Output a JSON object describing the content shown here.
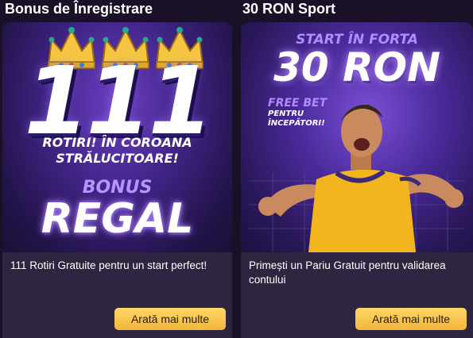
{
  "sections": [
    {
      "title": "Bonus de Înregistrare",
      "banner": {
        "number": "111",
        "line1": "ROTIRI! ÎN COROANA",
        "line2": "STRĂLUCITOARE!",
        "bonus": "BONUS",
        "regal": "REGAL"
      },
      "description": "111 Rotiri Gratuite pentru un start perfect!",
      "button_label": "Arată mai multe"
    },
    {
      "title": "30 RON Sport",
      "banner": {
        "start": "START ÎN FORTA",
        "amount": "30 RON",
        "free_bet": "FREE BET",
        "pentru": "PENTRU",
        "incepatori": "ÎNCEPĂTORI!"
      },
      "description": "Primești un Pariu Gratuit pentru validarea contului",
      "button_label": "Arată mai multe"
    }
  ],
  "colors": {
    "background": "#1a1128",
    "card": "#2e2540",
    "button": "#f5c04a",
    "accent_purple": "#b08cff"
  },
  "icons": {
    "crown": "crown-icon",
    "player": "football-player-illustration"
  }
}
